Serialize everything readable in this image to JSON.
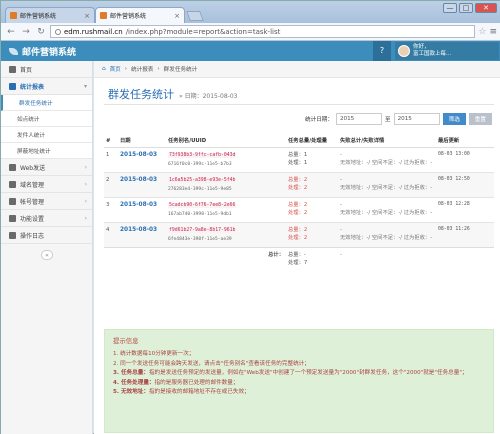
{
  "browser": {
    "tabs": [
      {
        "label": "邮件营销系统"
      },
      {
        "label": "邮件营销系统"
      }
    ],
    "url_prefix": "edm.rushmail.cn",
    "url_rest": "/index.php?module=report&action=task-list",
    "window_buttons": [
      "—",
      "□",
      "✕"
    ]
  },
  "header": {
    "brand": "邮件营销系统",
    "help": "?",
    "user_greeting": "你好，",
    "user_name": "富工国款上每..."
  },
  "sidebar": {
    "items": [
      {
        "label": "首页",
        "icon": "home-icon"
      },
      {
        "label": "统计报表",
        "icon": "chart-icon",
        "active": true
      },
      {
        "label": "Web发送",
        "icon": "globe-icon"
      },
      {
        "label": "域名管理",
        "icon": "gear-icon"
      },
      {
        "label": "帐号管理",
        "icon": "users-icon"
      },
      {
        "label": "功能设置",
        "icon": "wrench-icon"
      },
      {
        "label": "操作日志",
        "icon": "list-icon"
      }
    ],
    "subitems": [
      {
        "label": "群发任务统计"
      },
      {
        "label": "如点统计"
      },
      {
        "label": "发件人统计"
      },
      {
        "label": "屏蔽地址统计"
      }
    ],
    "collapse": "«"
  },
  "breadcrumb": [
    "首页",
    "统计报表",
    "群发任务统计"
  ],
  "page": {
    "title": "群发任务统计",
    "subtitle": "» 日期：2015-08-03"
  },
  "filter": {
    "label": "统计日期：",
    "from": "2015",
    "to_label": "至",
    "to": "2015",
    "filter_btn": "筛选",
    "reset_btn": "重置"
  },
  "table": {
    "headers": [
      "#",
      "日期",
      "任务别名/UUID",
      "任务总量/处理量",
      "失败总计/失败详情",
      "最后更新"
    ],
    "rows": [
      {
        "num": "1",
        "date": "2015-08-03",
        "tid": "73f938b3-9ffc-cafb-043d",
        "uuid": "6716f0c0-399c-11e5-b7b3",
        "total": "总量：1",
        "processed": "处理：1",
        "fail_total": "-",
        "fail_detail": "无效地址：-/ 空间不足：-/ 过为拒收：-",
        "updated": "08-03 13:00"
      },
      {
        "num": "2",
        "date": "2015-08-03",
        "tid": "1c6a5b25-a398-e93e-5f4b",
        "uuid": "276283e4-399c-11e5-9e85",
        "total": "总量：2",
        "processed": "处理：2",
        "fail_total": "-",
        "fail_detail": "无效地址：-/ 空间不足：-/ 过为拒收：-",
        "updated": "08-03 12:50"
      },
      {
        "num": "3",
        "date": "2015-08-03",
        "tid": "5cadcb90-6f76-7ee8-2e66",
        "uuid": "167ab740-3998-11e5-9db1",
        "total": "总量：2",
        "processed": "处理：2",
        "fail_total": "-",
        "fail_detail": "无效地址：-/ 空间不足：-/ 过为拒收：-",
        "updated": "08-03 12:28"
      },
      {
        "num": "4",
        "date": "2015-08-03",
        "tid": "f9d61b27-9a8e-8b17-961b",
        "uuid": "6fe4843e-398f-11e5-ae39",
        "total": "总量：2",
        "processed": "处理：2",
        "fail_total": "-",
        "fail_detail": "无效地址：-/ 空间不足：-/ 过为拒收：-",
        "updated": "08-03 11:26"
      }
    ],
    "summary": {
      "label": "总计：",
      "total": "总量：-",
      "processed": "处理：7",
      "fail": "-"
    }
  },
  "info": {
    "title": "提示信息",
    "items": [
      {
        "key": "",
        "text": "1. 统计数据每10分钟更新一次；"
      },
      {
        "key": "",
        "text": "2. 同一个发送任务可能会跨天发送，请点击\"任务别名\"查看该任务的完整统计；"
      },
      {
        "key": "3. 任务总量：",
        "text": "指的是发送任务预定的发送量，例如在\"Web发送\"中创建了一个预定发送量为\"2000\"封群发任务，这个\"2000\"就是\"任务总量\"；"
      },
      {
        "key": "4. 任务处理量：",
        "text": "指的是服务器已处理的邮件数量；"
      },
      {
        "key": "5. 无效地址：",
        "text": "指的是接收的邮箱地址不存在或已失效；"
      }
    ]
  },
  "colors": {
    "accent": "#3c8dbc",
    "link": "#2a6fb3",
    "alert_bg": "#dff0d8"
  }
}
